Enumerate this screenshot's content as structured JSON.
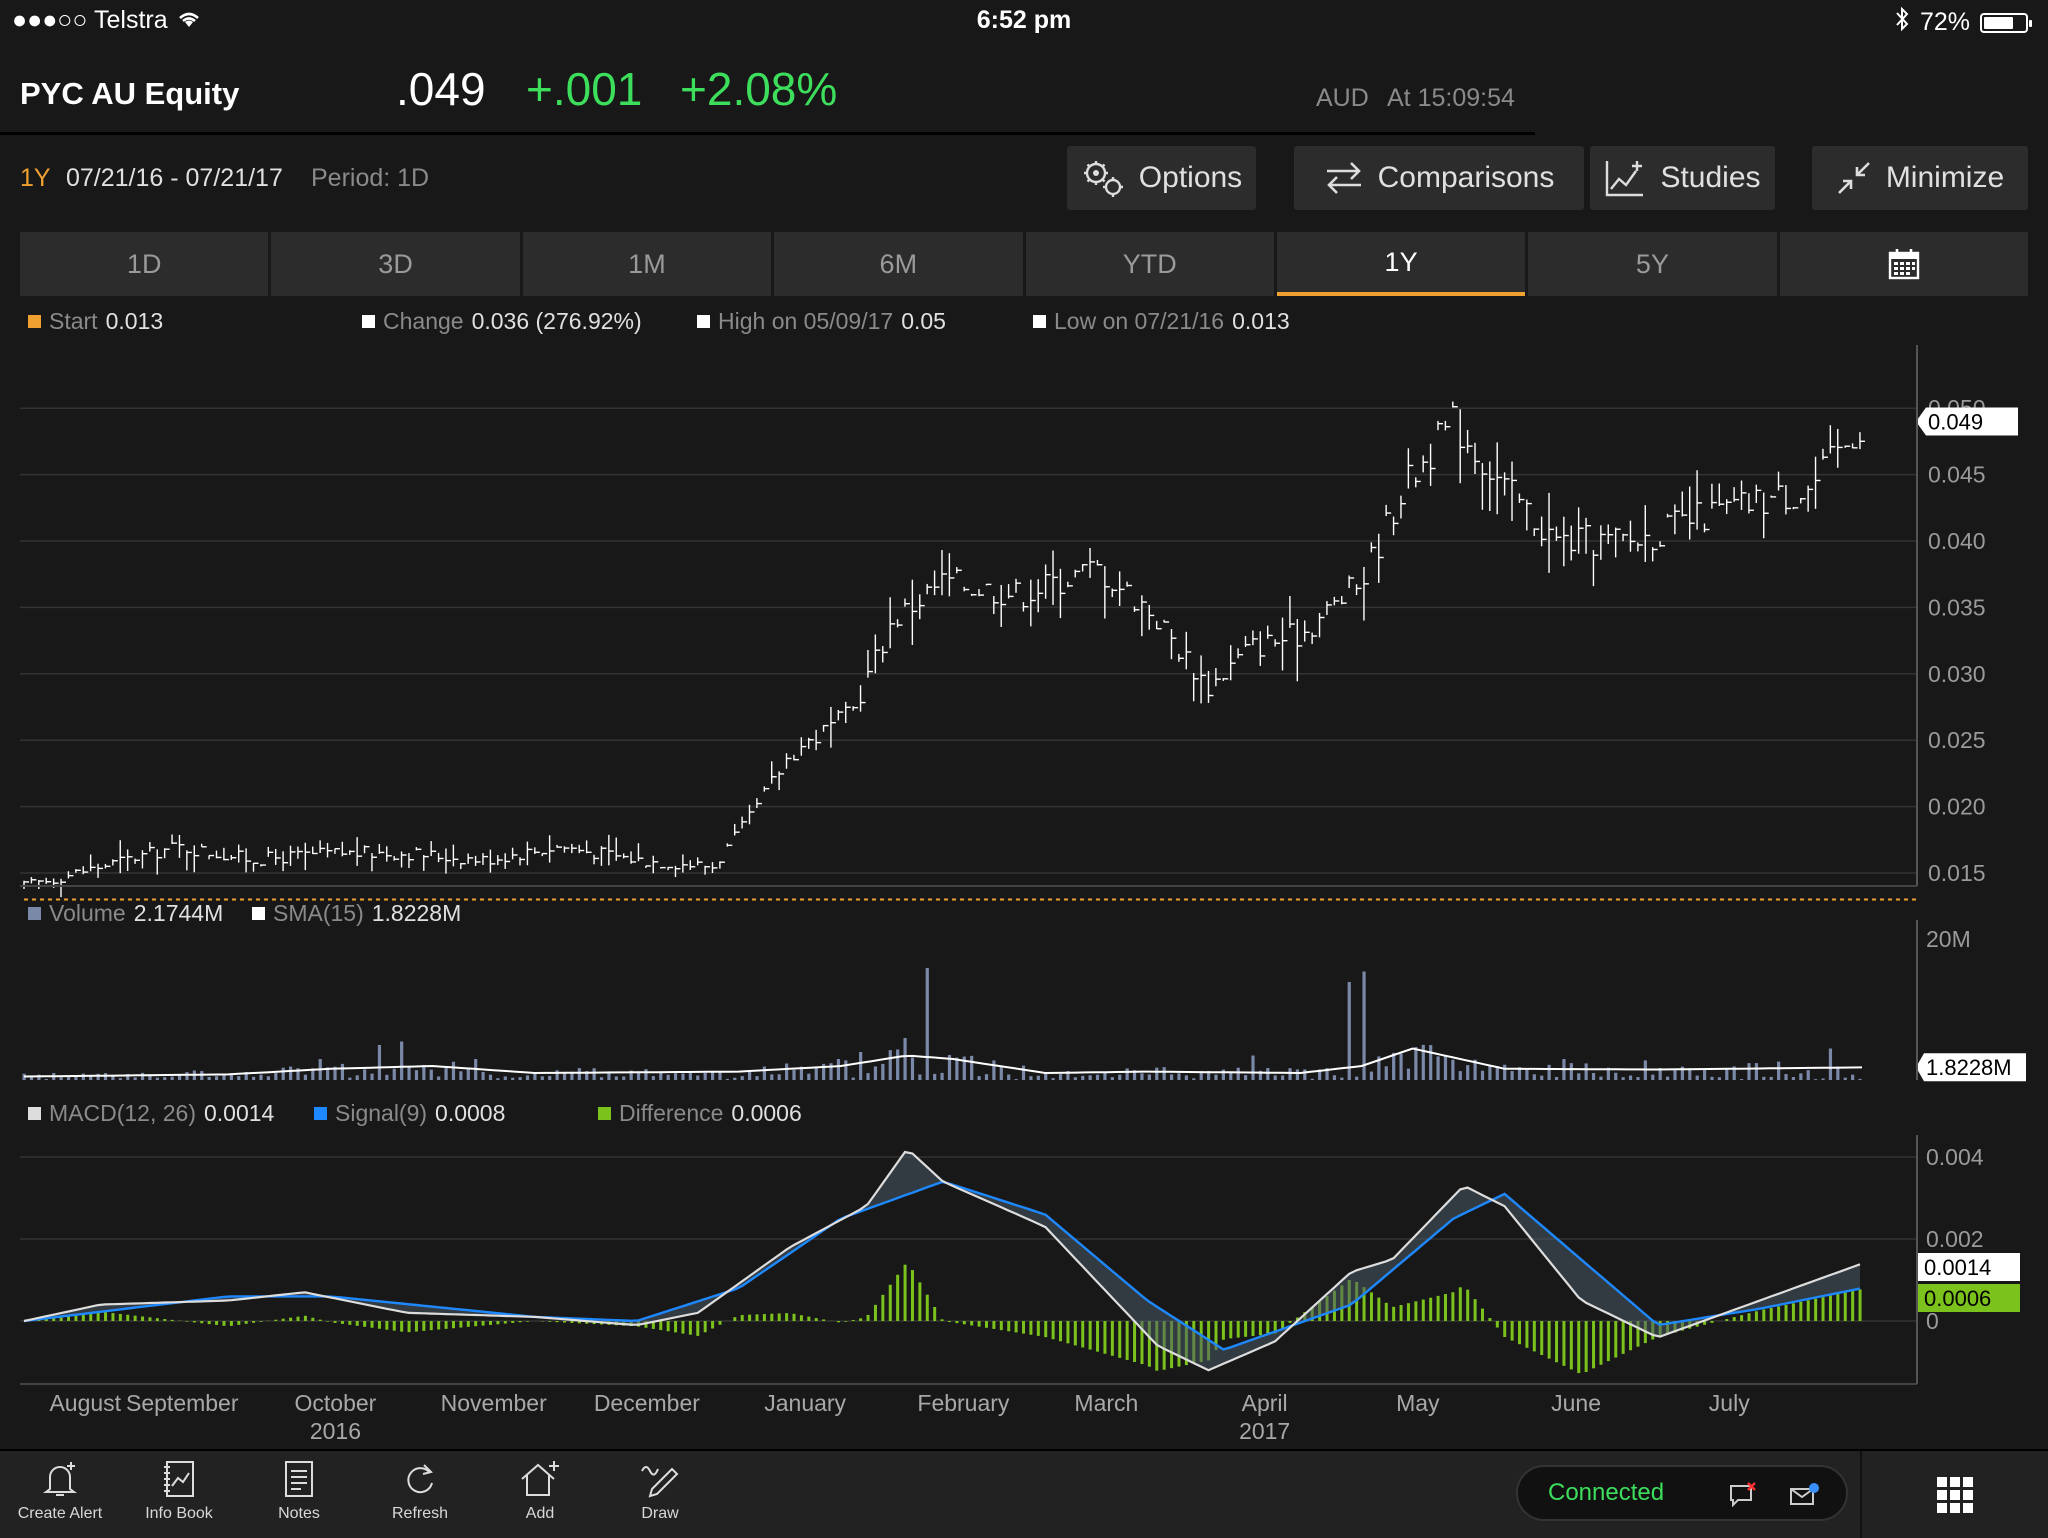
{
  "status_bar": {
    "carrier": "●●●○○ Telstra",
    "time": "6:52 pm",
    "battery": "72%",
    "battery_level": 0.72
  },
  "header": {
    "ticker": "PYC AU Equity",
    "price": ".049",
    "change": "+.001",
    "change_pct": "+2.08%",
    "currency": "AUD",
    "as_of": "At 15:09:54",
    "accent_color": "#3dde5c"
  },
  "toolbar": {
    "range_label": "1Y",
    "date_range": "07/21/16 - 07/21/17",
    "period": "Period: 1D",
    "options": "Options",
    "comparisons": "Comparisons",
    "studies": "Studies",
    "minimize": "Minimize"
  },
  "tabs": [
    "1D",
    "3D",
    "1M",
    "6M",
    "YTD",
    "1Y",
    "5Y"
  ],
  "active_tab": "1Y",
  "price_legend": {
    "start_label": "Start",
    "start_value": "0.013",
    "change_label": "Change",
    "change_value": "0.036 (276.92%)",
    "high_label": "High on 05/09/17",
    "high_value": "0.05",
    "low_label": "Low on 07/21/16",
    "low_value": "0.013"
  },
  "volume_legend": {
    "volume_label": "Volume",
    "volume_value": "2.1744M",
    "sma_label": "SMA(15)",
    "sma_value": "1.8228M"
  },
  "macd_legend": {
    "macd_label": "MACD(12, 26)",
    "macd_value": "0.0014",
    "signal_label": "Signal(9)",
    "signal_value": "0.0008",
    "diff_label": "Difference",
    "diff_value": "0.0006"
  },
  "chart_data": [
    {
      "type": "line",
      "name": "price",
      "y_ticks": [
        "0.015",
        "0.020",
        "0.025",
        "0.030",
        "0.035",
        "0.040",
        "0.045",
        "0.050"
      ],
      "ylim": [
        0.011,
        0.051
      ],
      "last_value_tag": "0.049",
      "start_level": 0.013,
      "x_months": [
        "August",
        "September",
        "October",
        "November",
        "December",
        "January",
        "February",
        "March",
        "April",
        "May",
        "June",
        "July"
      ],
      "x_years": [
        "2016",
        "2017"
      ],
      "x": [
        0,
        15,
        30,
        45,
        60,
        75,
        90,
        105,
        120,
        135,
        142,
        150,
        162,
        170,
        180,
        195,
        210,
        220,
        232,
        240,
        250,
        262,
        270,
        280,
        290,
        300,
        315,
        330,
        340,
        350,
        360
      ],
      "y": [
        0.014,
        0.0155,
        0.017,
        0.016,
        0.0165,
        0.0165,
        0.016,
        0.017,
        0.016,
        0.0155,
        0.019,
        0.024,
        0.027,
        0.034,
        0.037,
        0.036,
        0.038,
        0.035,
        0.029,
        0.032,
        0.033,
        0.037,
        0.044,
        0.049,
        0.044,
        0.04,
        0.04,
        0.042,
        0.043,
        0.044,
        0.049
      ]
    },
    {
      "type": "bar",
      "name": "volume",
      "y_tick": "20M",
      "ylim": [
        0,
        20
      ],
      "unit": "M",
      "last_value_tag": "1.8228M",
      "spikes_day": [
        58,
        66,
        70,
        74,
        79,
        88,
        114,
        164,
        173,
        177,
        241,
        260,
        262,
        285,
        302,
        318,
        354
      ],
      "spikes_value": [
        3,
        3.2,
        5,
        5.5,
        4,
        3,
        3.2,
        4,
        6,
        16,
        3.5,
        14,
        15.5,
        3,
        3,
        2.8,
        4.5
      ],
      "sma_day": [
        0,
        40,
        60,
        80,
        100,
        140,
        160,
        173,
        182,
        200,
        220,
        250,
        262,
        272,
        290,
        320,
        360
      ],
      "sma_value": [
        0.5,
        0.8,
        1.6,
        2.0,
        1.0,
        1.2,
        2.0,
        3.5,
        3.0,
        1.0,
        1.2,
        1.0,
        2.0,
        4.5,
        1.6,
        1.5,
        1.8
      ]
    },
    {
      "type": "line",
      "name": "macd",
      "y_ticks": [
        "0.004",
        "0.002",
        "0"
      ],
      "ylim": [
        -0.0014,
        0.0042
      ],
      "last_value_tags": [
        "0.0014",
        "0.0006"
      ],
      "macd_day": [
        0,
        15,
        40,
        55,
        75,
        100,
        120,
        132,
        150,
        165,
        173,
        180,
        200,
        222,
        232,
        245,
        260,
        268,
        282,
        290,
        305,
        320,
        340,
        360
      ],
      "macd_value": [
        0,
        0.0004,
        0.0005,
        0.0007,
        0.0002,
        0.0001,
        -0.0001,
        0.0002,
        0.0018,
        0.0028,
        0.0042,
        0.0034,
        0.0023,
        -0.0006,
        -0.0012,
        -0.0005,
        0.0012,
        0.0015,
        0.0033,
        0.0028,
        0.0005,
        -0.0004,
        0.0005,
        0.0014
      ],
      "signal_day": [
        0,
        40,
        60,
        100,
        120,
        140,
        160,
        180,
        200,
        220,
        235,
        260,
        280,
        290,
        320,
        340,
        360
      ],
      "signal_value": [
        0,
        0.0006,
        0.0006,
        0.0001,
        0.0,
        0.0008,
        0.0025,
        0.0034,
        0.0026,
        0.0005,
        -0.0007,
        0.0004,
        0.0025,
        0.0031,
        -0.0001,
        0.0003,
        0.0008
      ],
      "diff_color": "#7cc21c",
      "signal_color": "#1e88ff"
    }
  ],
  "bottom_bar": {
    "items": [
      "Create Alert",
      "Info Book",
      "Notes",
      "Refresh",
      "Add",
      "Draw"
    ],
    "connection": "Connected"
  },
  "colors": {
    "orange": "#f0a030",
    "green": "#3dde5c",
    "volume": "#7b89a8",
    "diff": "#7cc21c",
    "signal": "#1e88ff"
  }
}
